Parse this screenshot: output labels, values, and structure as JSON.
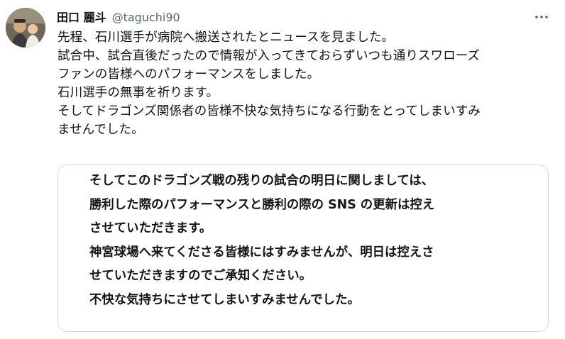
{
  "author": {
    "display_name": "田口 麗斗",
    "handle": "@taguchi90"
  },
  "more_icon": "more-horizontal-icon",
  "tweet_lines": [
    "先程、石川選手が病院へ搬送されたとニュースを見ました。",
    "試合中、試合直後だったので情報が入ってきておらずいつも通りスワローズ",
    "ファンの皆様へのパフォーマンスをしました。",
    "石川選手の無事を祈ります。",
    "そしてドラゴンズ関係者の皆様不快な気持ちになる行動をとってしまいすみ",
    "ませんでした。"
  ],
  "image_lines": [
    "そしてこのドラゴンズ戦の残りの試合の明日に関しましては、",
    "勝利した際のパフォーマンスと勝利の際の SNS の更新は控え",
    "させていただきます。",
    "神宮球場へ来てくださる皆様にはすみませんが、明日は控えさ",
    "せていただきますのでご承知ください。",
    "不快な気持ちにさせてしまいすみませんでした。"
  ]
}
